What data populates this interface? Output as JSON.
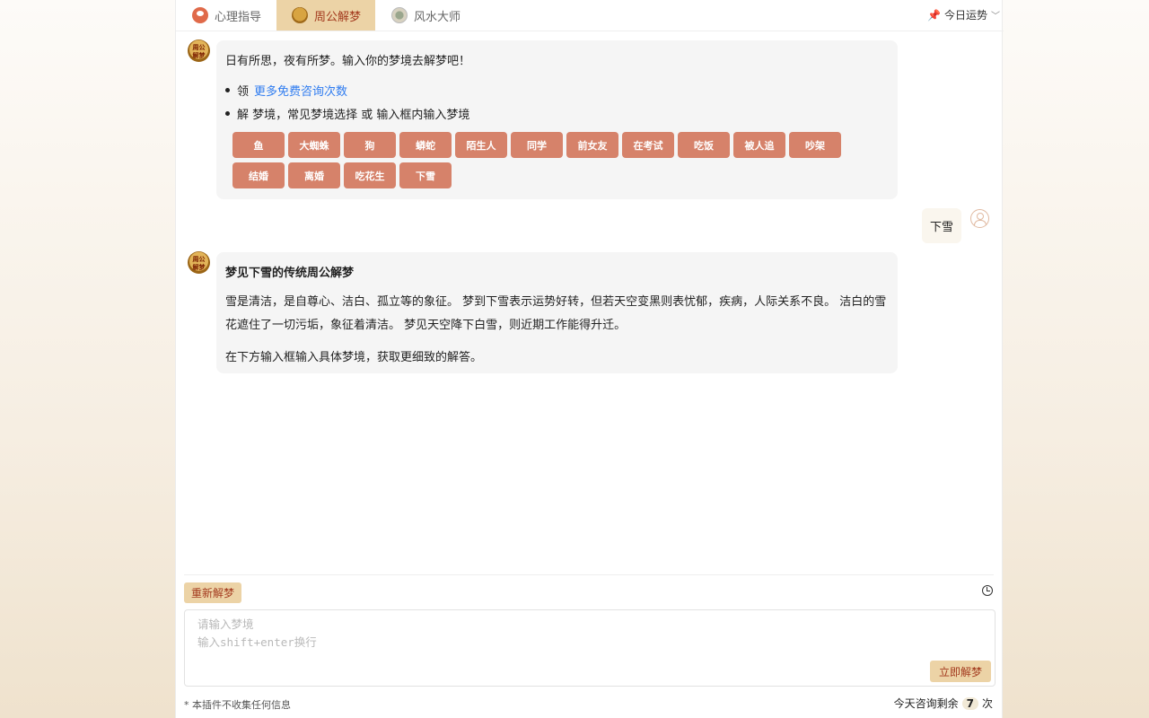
{
  "tabs": [
    {
      "label": "心理指导",
      "icon": "psychology-icon"
    },
    {
      "label": "周公解梦",
      "icon": "zhougong-icon",
      "active": true
    },
    {
      "label": "风水大师",
      "icon": "fengshui-icon"
    }
  ],
  "fortune": {
    "icon": "pin-icon",
    "label": "今日运势"
  },
  "bot_avatar_text": "周公解梦",
  "intro": {
    "greeting": "日有所思，夜有所梦。输入你的梦境去解梦吧！",
    "item1_prefix": "领",
    "item1_link": "更多免费咨询次数",
    "item2": "解 梦境，常见梦境选择 或 输入框内输入梦境",
    "chips": [
      "鱼",
      "大蜘蛛",
      "狗",
      "蟒蛇",
      "陌生人",
      "同学",
      "前女友",
      "在考试",
      "吃饭",
      "被人追",
      "吵架",
      "结婚",
      "离婚",
      "吃花生",
      "下雪"
    ]
  },
  "user_message": "下雪",
  "answer": {
    "title": "梦见下雪的传统周公解梦",
    "paragraph1": "雪是清洁，是自尊心、洁白、孤立等的象征。 梦到下雪表示运势好转，但若天空变黑则表忧郁，疾病，人际关系不良。 洁白的雪花遮住了一切污垢，象征着清洁。 梦见天空降下白雪，则近期工作能得升迁。",
    "paragraph2": "在下方输入框输入具体梦境，获取更细致的解答。"
  },
  "controls": {
    "reset_label": "重新解梦",
    "input_placeholder": "请输入梦境\n输入shift+enter换行",
    "submit_label": "立即解梦"
  },
  "footer": {
    "privacy": "* 本插件不收集任何信息",
    "quota_prefix": "今天咨询剩余",
    "quota_count": "7",
    "quota_suffix": "次"
  },
  "colors": {
    "accent": "#ecd3a6",
    "accent_text": "#a33a1e",
    "chip": "#d6826a",
    "link": "#2f7cf0"
  }
}
